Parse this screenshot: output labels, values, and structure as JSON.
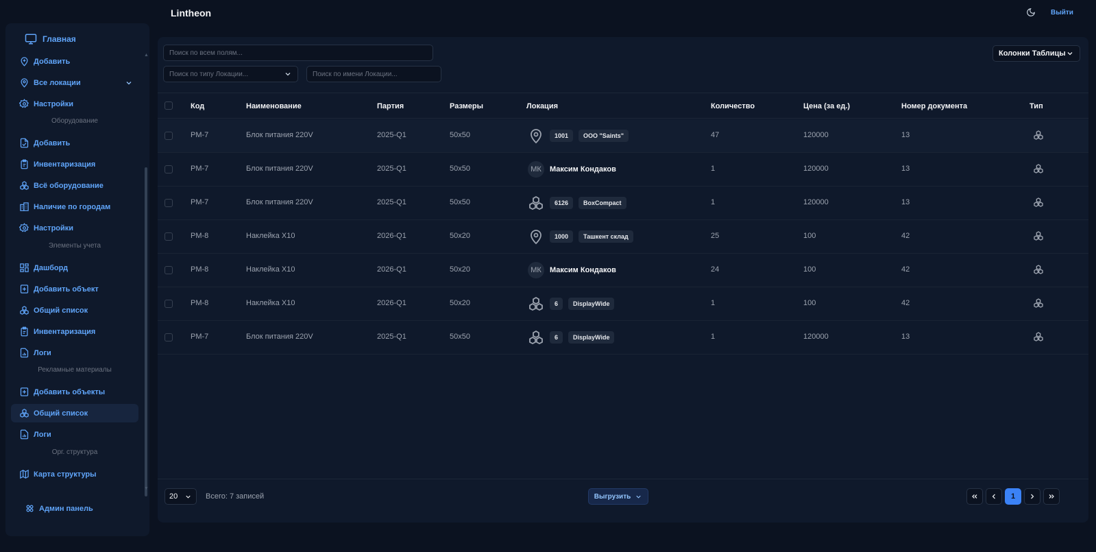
{
  "app": {
    "title": "Lintheon",
    "logout_label": "Выйти",
    "theme_icon": "moon-icon"
  },
  "sidebar": {
    "home_label": "Главная",
    "items": [
      {
        "label": "Добавить",
        "icon": "location-add-icon"
      },
      {
        "label": "Все локации",
        "icon": "location-icon"
      },
      {
        "label": "Настройки",
        "icon": "gear-icon"
      },
      {
        "label": "Добавить",
        "icon": "file-import-icon"
      },
      {
        "label": "Инвентаризация",
        "icon": "clipboard-icon"
      },
      {
        "label": "Всё оборудование",
        "icon": "boxes-icon"
      },
      {
        "label": "Наличие по городам",
        "icon": "buildings-icon"
      },
      {
        "label": "Настройки",
        "icon": "gear-icon"
      },
      {
        "label": "Дашборд",
        "icon": "dashboard-icon"
      },
      {
        "label": "Добавить объект",
        "icon": "add-box-icon"
      },
      {
        "label": "Общий список",
        "icon": "boxes-icon"
      },
      {
        "label": "Инвентаризация",
        "icon": "clipboard-icon"
      },
      {
        "label": "Логи",
        "icon": "chart-file-icon"
      },
      {
        "label": "Добавить объекты",
        "icon": "add-box-icon"
      },
      {
        "label": "Общий список",
        "icon": "boxes-icon"
      },
      {
        "label": "Логи",
        "icon": "chart-file-icon"
      },
      {
        "label": "Карта структуры",
        "icon": "map-icon"
      }
    ],
    "groups": [
      "Оборудование",
      "Элементы учета",
      "Рекламные материалы",
      "Орг. структура"
    ],
    "admin_label": "Админ панель"
  },
  "filters": {
    "search_all_placeholder": "Поиск по всем полям...",
    "location_type_placeholder": "Поиск по типу Локации...",
    "location_name_placeholder": "Поиск по имени Локации...",
    "columns_label": "Колонки Таблицы"
  },
  "table": {
    "headers": [
      "Код",
      "Наименование",
      "Партия",
      "Размеры",
      "Локация",
      "Количество",
      "Цена (за ед.)",
      "Номер документа",
      "Тип"
    ],
    "rows": [
      {
        "code": "PM-7",
        "name": "Блок питания 220V",
        "batch": "2025-Q1",
        "size": "50x50",
        "loc_kind": "pin",
        "loc_id": "1001",
        "loc_name": "ООО \"Saints\"",
        "qty": "47",
        "price": "120000",
        "doc": "13"
      },
      {
        "code": "PM-7",
        "name": "Блок питания 220V",
        "batch": "2025-Q1",
        "size": "50x50",
        "loc_kind": "person",
        "avatar": "МК",
        "person": "Максим Кондаков",
        "qty": "1",
        "price": "120000",
        "doc": "13"
      },
      {
        "code": "PM-7",
        "name": "Блок питания 220V",
        "batch": "2025-Q1",
        "size": "50x50",
        "loc_kind": "boxes",
        "loc_id": "6126",
        "loc_name": "BoxCompact",
        "qty": "1",
        "price": "120000",
        "doc": "13"
      },
      {
        "code": "PM-8",
        "name": "Наклейка X10",
        "batch": "2026-Q1",
        "size": "50x20",
        "loc_kind": "pin",
        "loc_id": "1000",
        "loc_name": "Ташкент склад",
        "qty": "25",
        "price": "100",
        "doc": "42"
      },
      {
        "code": "PM-8",
        "name": "Наклейка X10",
        "batch": "2026-Q1",
        "size": "50x20",
        "loc_kind": "person",
        "avatar": "МК",
        "person": "Максим Кондаков",
        "qty": "24",
        "price": "100",
        "doc": "42"
      },
      {
        "code": "PM-8",
        "name": "Наклейка X10",
        "batch": "2026-Q1",
        "size": "50x20",
        "loc_kind": "boxes",
        "loc_id": "6",
        "loc_name": "DisplayWide",
        "qty": "1",
        "price": "100",
        "doc": "42"
      },
      {
        "code": "PM-7",
        "name": "Блок питания 220V",
        "batch": "2025-Q1",
        "size": "50x50",
        "loc_kind": "boxes",
        "loc_id": "6",
        "loc_name": "DisplayWide",
        "qty": "1",
        "price": "120000",
        "doc": "13"
      }
    ]
  },
  "footer": {
    "page_size": "20",
    "total_label": "Всего: 7 записей",
    "export_label": "Выгрузить",
    "current_page": "1"
  }
}
